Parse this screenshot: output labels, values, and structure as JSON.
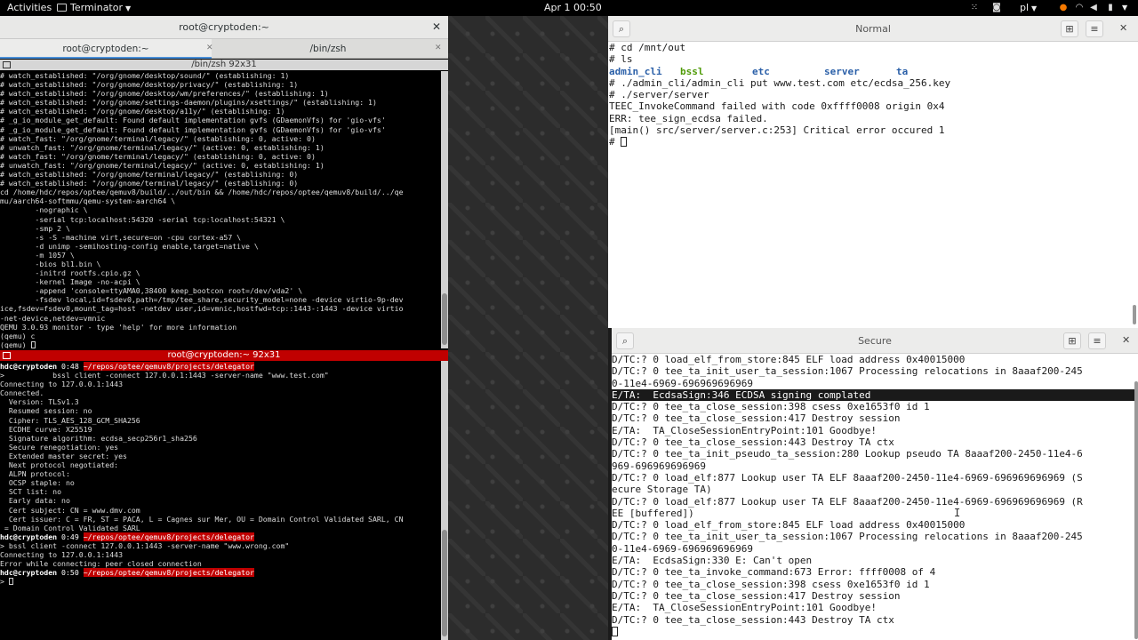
{
  "topbar": {
    "activities": "Activities",
    "app": "Terminator",
    "clock": "Apr 1  00:50",
    "lang": "pl"
  },
  "terminator": {
    "title": "root@cryptoden:~",
    "tabs": [
      {
        "label": "root@cryptoden:~"
      },
      {
        "label": "/bin/zsh"
      }
    ],
    "pane1": {
      "header": "/bin/zsh 92x31",
      "lines": [
        "# watch_established: \"/org/gnome/desktop/sound/\" (establishing: 1)",
        "# watch_established: \"/org/gnome/desktop/privacy/\" (establishing: 1)",
        "# watch_established: \"/org/gnome/desktop/wm/preferences/\" (establishing: 1)",
        "# watch_established: \"/org/gnome/settings-daemon/plugins/xsettings/\" (establishing: 1)",
        "# watch_established: \"/org/gnome/desktop/a11y/\" (establishing: 1)",
        "# _g_io_module_get_default: Found default implementation gvfs (GDaemonVfs) for 'gio-vfs'",
        "# _g_io_module_get_default: Found default implementation gvfs (GDaemonVfs) for 'gio-vfs'",
        "# watch_fast: \"/org/gnome/terminal/legacy/\" (establishing: 0, active: 0)",
        "# unwatch_fast: \"/org/gnome/terminal/legacy/\" (active: 0, establishing: 1)",
        "# watch_fast: \"/org/gnome/terminal/legacy/\" (establishing: 0, active: 0)",
        "# unwatch_fast: \"/org/gnome/terminal/legacy/\" (active: 0, establishing: 1)",
        "# watch_established: \"/org/gnome/terminal/legacy/\" (establishing: 0)",
        "# watch_established: \"/org/gnome/terminal/legacy/\" (establishing: 0)",
        "cd /home/hdc/repos/optee/qemuv8/build/../out/bin && /home/hdc/repos/optee/qemuv8/build/../qe",
        "mu/aarch64-softmmu/qemu-system-aarch64 \\",
        "        -nographic \\",
        "        -serial tcp:localhost:54320 -serial tcp:localhost:54321 \\",
        "        -smp 2 \\",
        "        -s -S -machine virt,secure=on -cpu cortex-a57 \\",
        "        -d unimp -semihosting-config enable,target=native \\",
        "        -m 1057 \\",
        "        -bios bl1.bin \\",
        "        -initrd rootfs.cpio.gz \\",
        "        -kernel Image -no-acpi \\",
        "        -append 'console=ttyAMA0,38400 keep_bootcon root=/dev/vda2' \\",
        "        -fsdev local,id=fsdev0,path=/tmp/tee_share,security_model=none -device virtio-9p-dev",
        "ice,fsdev=fsdev0,mount_tag=host -netdev user,id=vmnic,hostfwd=tcp::1443-:1443 -device virtio",
        "-net-device,netdev=vmnic",
        "QEMU 3.0.93 monitor - type 'help' for more information",
        "(qemu) c",
        "(qemu) "
      ]
    },
    "pane2": {
      "header": "root@cryptoden:~ 92x31",
      "prompt_user": "hdc@cryptoden",
      "prompt1_time": "0:48",
      "prompt2_time": "0:49",
      "prompt3_time": "0:50",
      "prompt_path": "~/repos/optee/qemuv8/projects/delegator",
      "cmd1": ">           bssl client -connect 127.0.0.1:1443 -server-name \"www.test.com\"",
      "lines1": [
        "Connecting to 127.0.0.1:1443",
        "Connected.",
        "  Version: TLSv1.3",
        "  Resumed session: no",
        "  Cipher: TLS_AES_128_GCM_SHA256",
        "  ECDHE curve: X25519",
        "  Signature algorithm: ecdsa_secp256r1_sha256",
        "  Secure renegotiation: yes",
        "  Extended master secret: yes",
        "  Next protocol negotiated:",
        "  ALPN protocol:",
        "  OCSP staple: no",
        "  SCT list: no",
        "  Early data: no",
        "  Cert subject: CN = www.dmv.com",
        "  Cert issuer: C = FR, ST = PACA, L = Cagnes sur Mer, OU = Domain Control Validated SARL, CN",
        " = Domain Control Validated SARL"
      ],
      "cmd2": "> bssl client -connect 127.0.0.1:1443 -server-name \"www.wrong.com\"",
      "lines2": [
        "Connecting to 127.0.0.1:1443",
        "Error while connecting: peer closed connection"
      ],
      "cmd3": "> "
    }
  },
  "normal": {
    "title": "Normal",
    "cmd_cd": "# cd /mnt/out",
    "cmd_ls": "# ls",
    "ls_items": [
      "admin_cli",
      "bssl",
      "etc",
      "server",
      "ta"
    ],
    "lines": [
      "# ./admin_cli/admin_cli put www.test.com etc/ecdsa_256.key",
      "# ./server/server",
      "TEEC_InvokeCommand failed with code 0xffff0008 origin 0x4",
      "ERR: tee_sign_ecdsa failed.",
      "[main() src/server/server.c:253] Critical error occured 1"
    ],
    "prompt": "# "
  },
  "secure": {
    "title": "Secure",
    "lines": [
      "D/TC:? 0 load_elf_from_store:845 ELF load address 0x40015000",
      "D/TC:? 0 tee_ta_init_user_ta_session:1067 Processing relocations in 8aaaf200-245",
      "0-11e4-6969-696969696969",
      "E/TA:  EcdsaSign:346 ECDSA signing complated",
      "D/TC:? 0 tee_ta_close_session:398 csess 0xe1653f0 id 1",
      "D/TC:? 0 tee_ta_close_session:417 Destroy session",
      "E/TA:  TA_CloseSessionEntryPoint:101 Goodbye!",
      "D/TC:? 0 tee_ta_close_session:443 Destroy TA ctx",
      "D/TC:? 0 tee_ta_init_pseudo_ta_session:280 Lookup pseudo TA 8aaaf200-2450-11e4-6",
      "969-696969696969",
      "D/TC:? 0 load_elf:877 Lookup user TA ELF 8aaaf200-2450-11e4-6969-696969696969 (S",
      "ecure Storage TA)",
      "D/TC:? 0 load_elf:877 Lookup user TA ELF 8aaaf200-2450-11e4-6969-696969696969 (R",
      "EE [buffered])",
      "D/TC:? 0 load_elf_from_store:845 ELF load address 0x40015000",
      "D/TC:? 0 tee_ta_init_user_ta_session:1067 Processing relocations in 8aaaf200-245",
      "0-11e4-6969-696969696969",
      "E/TA:  EcdsaSign:330 E: Can't open",
      "D/TC:? 0 tee_ta_invoke_command:673 Error: ffff0008 of 4",
      "D/TC:? 0 tee_ta_close_session:398 csess 0xe1653f0 id 1",
      "D/TC:? 0 tee_ta_close_session:417 Destroy session",
      "E/TA:  TA_CloseSessionEntryPoint:101 Goodbye!",
      "D/TC:? 0 tee_ta_close_session:443 Destroy TA ctx"
    ],
    "highlight_index": 3
  },
  "icons": {
    "search": "search-icon",
    "new_tab": "new-tab-icon",
    "menu": "hamburger-menu-icon",
    "close": "close-icon"
  },
  "colors": {
    "prompt_red": "#c00000",
    "ls_dir": "#2a5fa8",
    "ls_exec": "#4e9a06"
  }
}
